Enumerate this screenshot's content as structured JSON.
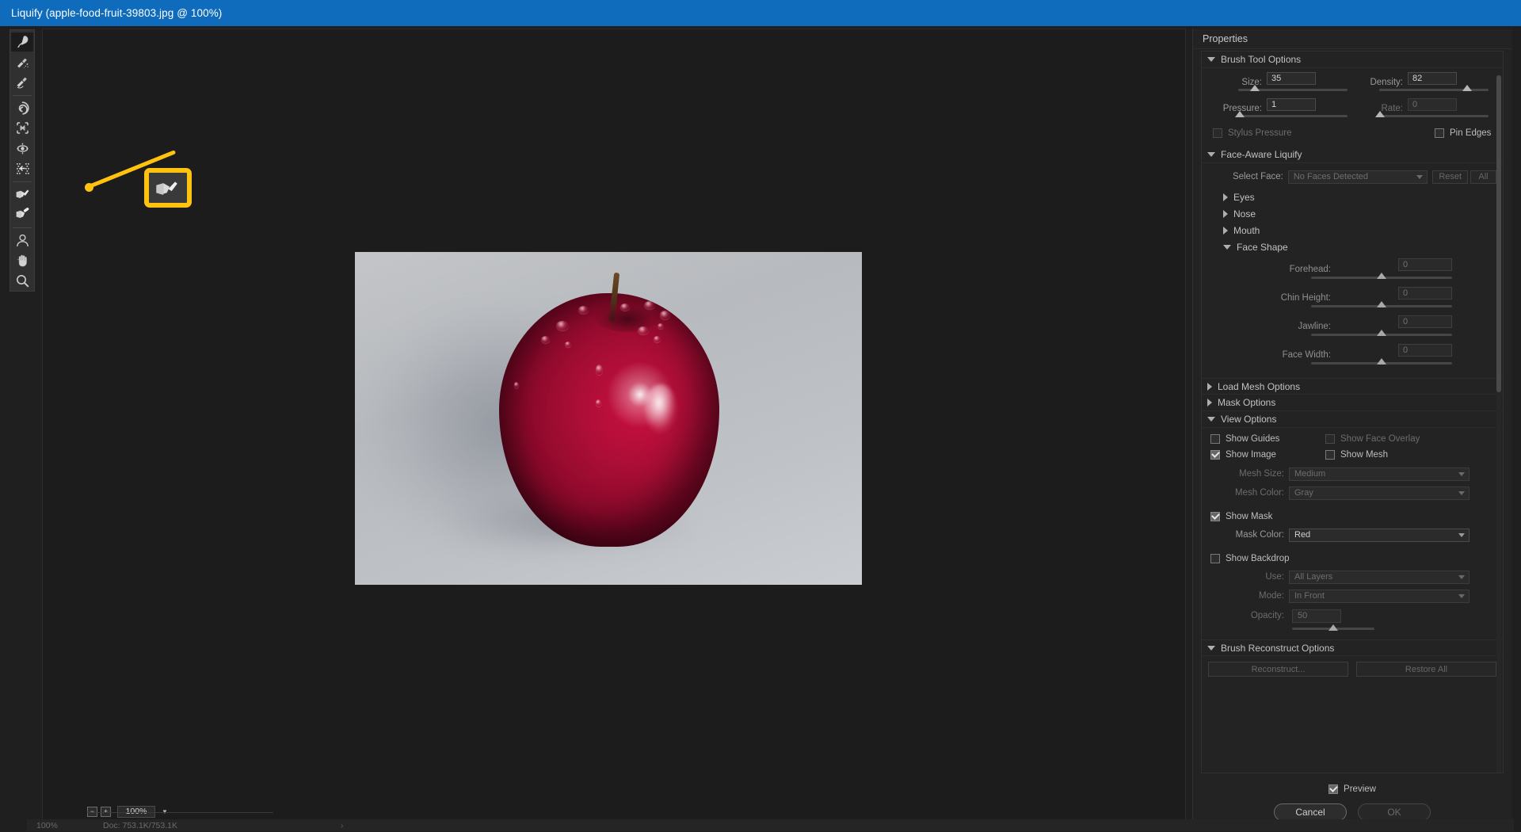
{
  "window": {
    "title": "Liquify (apple-food-fruit-39803.jpg @ 100%)"
  },
  "toolbar": {
    "tools": [
      {
        "name": "forward-warp-tool",
        "label": "Forward Warp Tool",
        "selected": true
      },
      {
        "name": "reconstruct-tool",
        "label": "Reconstruct Tool",
        "selected": false
      },
      {
        "name": "smooth-tool",
        "label": "Smooth Tool",
        "selected": false
      },
      {
        "name": "twirl-clockwise-tool",
        "label": "Twirl Clockwise Tool",
        "selected": false
      },
      {
        "name": "pucker-tool",
        "label": "Pucker Tool",
        "selected": false
      },
      {
        "name": "bloat-tool",
        "label": "Bloat Tool",
        "selected": false
      },
      {
        "name": "push-left-tool",
        "label": "Push Left Tool",
        "selected": false
      },
      {
        "name": "freeze-mask-tool",
        "label": "Freeze Mask Tool",
        "selected": false
      },
      {
        "name": "thaw-mask-tool",
        "label": "Thaw Mask Tool",
        "selected": false
      },
      {
        "name": "face-tool",
        "label": "Face Tool",
        "selected": false
      },
      {
        "name": "hand-tool",
        "label": "Hand Tool",
        "selected": false
      },
      {
        "name": "zoom-tool",
        "label": "Zoom Tool",
        "selected": false
      }
    ]
  },
  "annotation": {
    "highlight_color": "#FFC20E",
    "target_tool": "freeze-mask-tool"
  },
  "canvas": {
    "zoom_minus": "−",
    "zoom_plus": "+",
    "zoom_level": "100%",
    "image_alt": "red apple with water droplets on gray background"
  },
  "status_bar": {
    "zoom": "100%",
    "doc": "Doc: 753.1K/753.1K",
    "arrow": "›"
  },
  "properties": {
    "title": "Properties",
    "brush_tool_options": {
      "header": "Brush Tool Options",
      "expanded": true,
      "size": {
        "label": "Size:",
        "value": "35",
        "slider_pct": 17
      },
      "density": {
        "label": "Density:",
        "value": "82",
        "slider_pct": 82
      },
      "pressure": {
        "label": "Pressure:",
        "value": "1",
        "slider_pct": 1
      },
      "rate": {
        "label": "Rate:",
        "value": "0",
        "slider_pct": 0,
        "disabled": true
      },
      "stylus_pressure": {
        "label": "Stylus Pressure",
        "checked": false,
        "disabled": true
      },
      "pin_edges": {
        "label": "Pin Edges",
        "checked": false,
        "disabled": false
      }
    },
    "face_aware_liquify": {
      "header": "Face-Aware Liquify",
      "expanded": true,
      "select_face": {
        "label": "Select Face:",
        "value": "No Faces Detected",
        "disabled": true
      },
      "reset_button": "Reset",
      "all_button": "All",
      "subsections": [
        {
          "label": "Eyes",
          "expanded": false
        },
        {
          "label": "Nose",
          "expanded": false
        },
        {
          "label": "Mouth",
          "expanded": false
        },
        {
          "label": "Face Shape",
          "expanded": true
        }
      ],
      "face_shape": [
        {
          "label": "Forehead:",
          "value": "0",
          "slider_pct": 50
        },
        {
          "label": "Chin Height:",
          "value": "0",
          "slider_pct": 50
        },
        {
          "label": "Jawline:",
          "value": "0",
          "slider_pct": 50
        },
        {
          "label": "Face Width:",
          "value": "0",
          "slider_pct": 50
        }
      ]
    },
    "load_mesh_options": {
      "header": "Load Mesh Options",
      "expanded": false
    },
    "mask_options": {
      "header": "Mask Options",
      "expanded": false
    },
    "view_options": {
      "header": "View Options",
      "expanded": true,
      "show_guides": {
        "label": "Show Guides",
        "checked": false,
        "disabled": false
      },
      "show_face_overlay": {
        "label": "Show Face Overlay",
        "checked": false,
        "disabled": true
      },
      "show_image": {
        "label": "Show Image",
        "checked": true,
        "disabled": false
      },
      "show_mesh": {
        "label": "Show Mesh",
        "checked": false,
        "disabled": false
      },
      "mesh_size": {
        "label": "Mesh Size:",
        "value": "Medium",
        "disabled": true
      },
      "mesh_color": {
        "label": "Mesh Color:",
        "value": "Gray",
        "disabled": true
      },
      "show_mask": {
        "label": "Show Mask",
        "checked": true,
        "disabled": false
      },
      "mask_color": {
        "label": "Mask Color:",
        "value": "Red",
        "disabled": false
      },
      "show_backdrop": {
        "label": "Show Backdrop",
        "checked": false,
        "disabled": false
      },
      "use": {
        "label": "Use:",
        "value": "All Layers",
        "disabled": true
      },
      "mode": {
        "label": "Mode:",
        "value": "In Front",
        "disabled": true
      },
      "opacity": {
        "label": "Opacity:",
        "value": "50",
        "slider_pct": 50,
        "disabled": true
      }
    },
    "brush_reconstruct_options": {
      "header": "Brush Reconstruct Options",
      "expanded": true,
      "reconstruct_button": "Reconstruct...",
      "restore_all_button": "Restore All"
    },
    "footer": {
      "preview": {
        "label": "Preview",
        "checked": true
      },
      "cancel_button": "Cancel",
      "ok_button": "OK"
    }
  }
}
